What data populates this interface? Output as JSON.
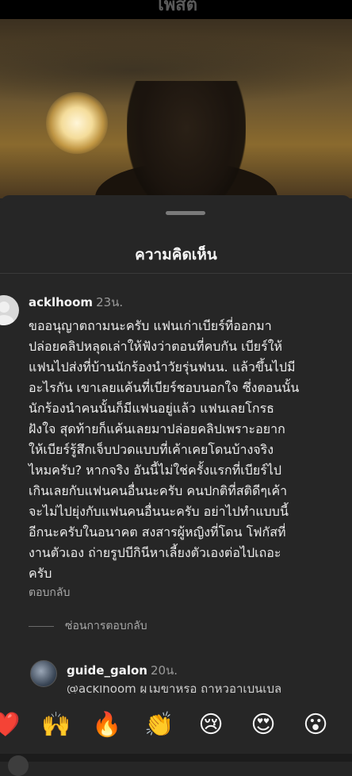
{
  "header": {
    "title": "โพสต์"
  },
  "comments_sheet": {
    "title": "ความคิดเห็น"
  },
  "comment": {
    "username": "acklhoom",
    "time": "23น.",
    "text": "ขออนุญาตถามนะครับ แฟนเก่าเบียร์ที่ออกมา\nปล่อยคลิปหลุดเล่าให้ฟังว่าตอนที่คบกัน เบียร์ให้\nแฟนไปส่งที่บ้านนักร้องนำวัยรุ่นฟนน.  แล้วขึ้นไปมี\nอะไรกัน เขาเลยแค้นที่เบียร์ชอบนอกใจ ซึ่งตอนนั้น\nนักร้องนำคนนั้นก็มีแฟนอยู่แล้ว แฟนเลยโกรธ\nฝังใจ สุดท้ายก็แค้นเลยมาปล่อยคลิปเพราะอยาก\nให้เบียร์รู้สึกเจ็บปวดแบบที่เค้าเคยโดนบ้างจริง\nไหมครับ? หากจริง อันนี้ไม่ใช่ครั้งแรกที่เบียร์ไป\nเกินเลยกับแฟนคนอื่นนะครับ คนปกติที่สติดีๆเค้า\nจะไม่ไปยุ่งกับแฟนคนอื่นนะครับ อย่าไปทำแบบนี้\nอีกนะครับในอนาคต สงสารผู้หญิงที่โดน โฟกัสที่\nงานตัวเอง ถ่ายรูปบีกินีหาเลี้ยงตัวเองต่อไปเถอะ\nครับ",
    "reply_label": "ตอบกลับ",
    "hide_replies_label": "ซ่อนการตอบกลับ"
  },
  "reply": {
    "username": "guide_galon",
    "time": "20น.",
    "text_peek": "@acklhoom ผู้ไม่ขำหรือ ถ้าหิวอาเป็นเปล"
  },
  "reactions": [
    "❤️",
    "🙌",
    "🔥",
    "👏",
    "😢",
    "😍",
    "😮"
  ]
}
